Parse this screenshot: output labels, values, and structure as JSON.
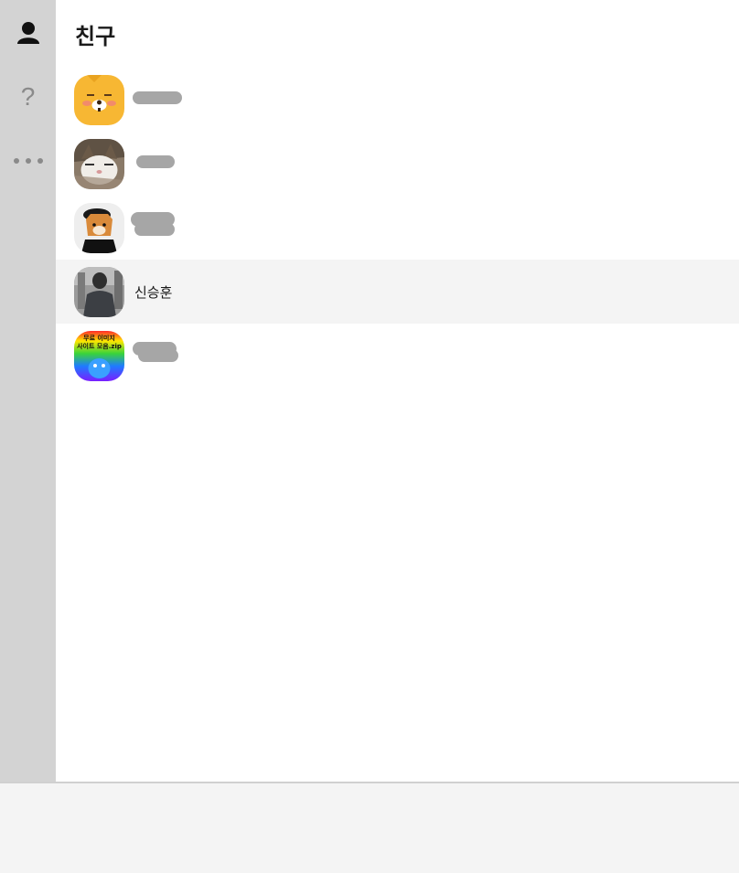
{
  "sidebar": {
    "items": [
      {
        "icon": "person-icon"
      },
      {
        "icon": "help-icon",
        "glyph": "?"
      },
      {
        "icon": "more-icon"
      }
    ]
  },
  "header": {
    "title": "친구"
  },
  "friends": [
    {
      "name": "",
      "avatar": "yellow-character-avatar",
      "name_redacted": true
    },
    {
      "name": "",
      "avatar": "cat-photo-avatar",
      "name_redacted": true
    },
    {
      "name": "",
      "avatar": "shiba-dog-avatar",
      "name_redacted": true
    },
    {
      "name": "신승훈",
      "avatar": "person-back-photo-avatar",
      "selected": true
    },
    {
      "name": "",
      "avatar": "rainbow-image-avatar",
      "name_redacted": true,
      "avatar_text": [
        "무료 이미지",
        "사이트 모음.zip"
      ]
    }
  ],
  "colors": {
    "sidebar_bg": "#d3d3d3",
    "selected_row_bg": "#f4f4f4",
    "redaction": "#a6a6a6"
  }
}
